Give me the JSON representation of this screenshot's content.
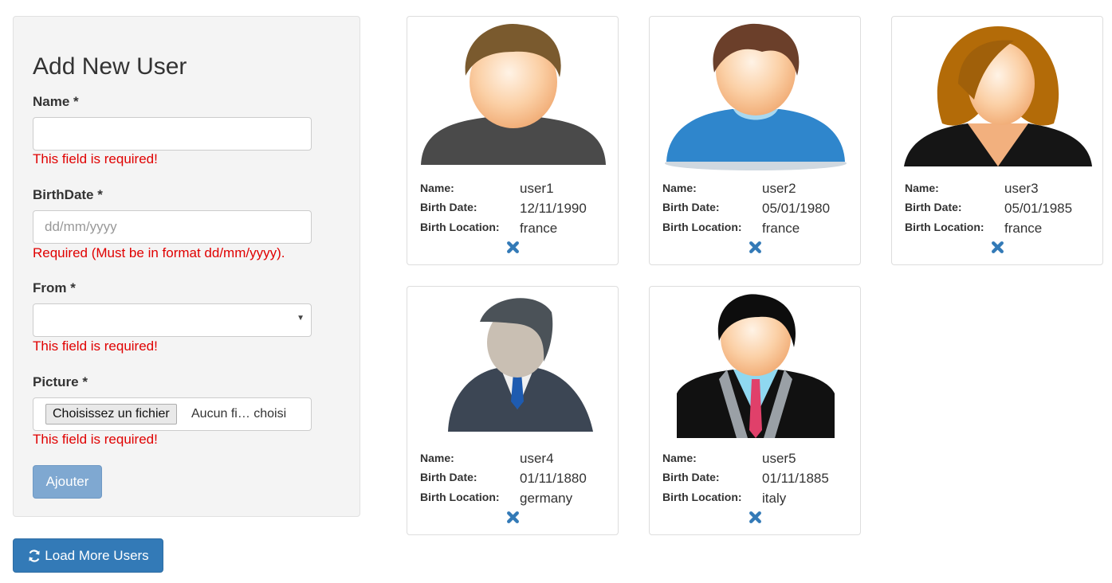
{
  "form": {
    "title": "Add New User",
    "name_label": "Name *",
    "name_value": "",
    "name_error": "This field is required!",
    "birthdate_label": "BirthDate *",
    "birthdate_placeholder": "dd/mm/yyyy",
    "birthdate_error": "Required (Must be in format dd/mm/yyyy).",
    "from_label": "From *",
    "from_selected": "",
    "from_error": "This field is required!",
    "picture_label": "Picture *",
    "file_button_label": "Choisissez un fichier",
    "file_status": "Aucun fi… choisi",
    "picture_error": "This field is required!",
    "submit_label": "Ajouter"
  },
  "load_more_label": "Load More Users",
  "info_labels": {
    "name": "Name:",
    "birth_date": "Birth Date:",
    "birth_location": "Birth Location:"
  },
  "users": [
    {
      "name": "user1",
      "birth_date": "12/11/1990",
      "birth_location": "france",
      "avatar": "man-brown-hair-gray-shirt-avatar"
    },
    {
      "name": "user2",
      "birth_date": "05/01/1980",
      "birth_location": "france",
      "avatar": "young-man-blue-shirt-avatar"
    },
    {
      "name": "user3",
      "birth_date": "05/01/1985",
      "birth_location": "france",
      "avatar": "woman-brown-hair-avatar"
    },
    {
      "name": "user4",
      "birth_date": "01/11/1880",
      "birth_location": "germany",
      "avatar": "businessman-gray-suit-avatar"
    },
    {
      "name": "user5",
      "birth_date": "01/11/1885",
      "birth_location": "italy",
      "avatar": "man-black-hair-pink-tie-avatar"
    }
  ],
  "colors": {
    "primary": "#337ab7",
    "error": "#e00000",
    "remove_icon": "#337ab7",
    "panel_bg": "#f4f4f4",
    "disabled_button": "#7fa8d1"
  }
}
